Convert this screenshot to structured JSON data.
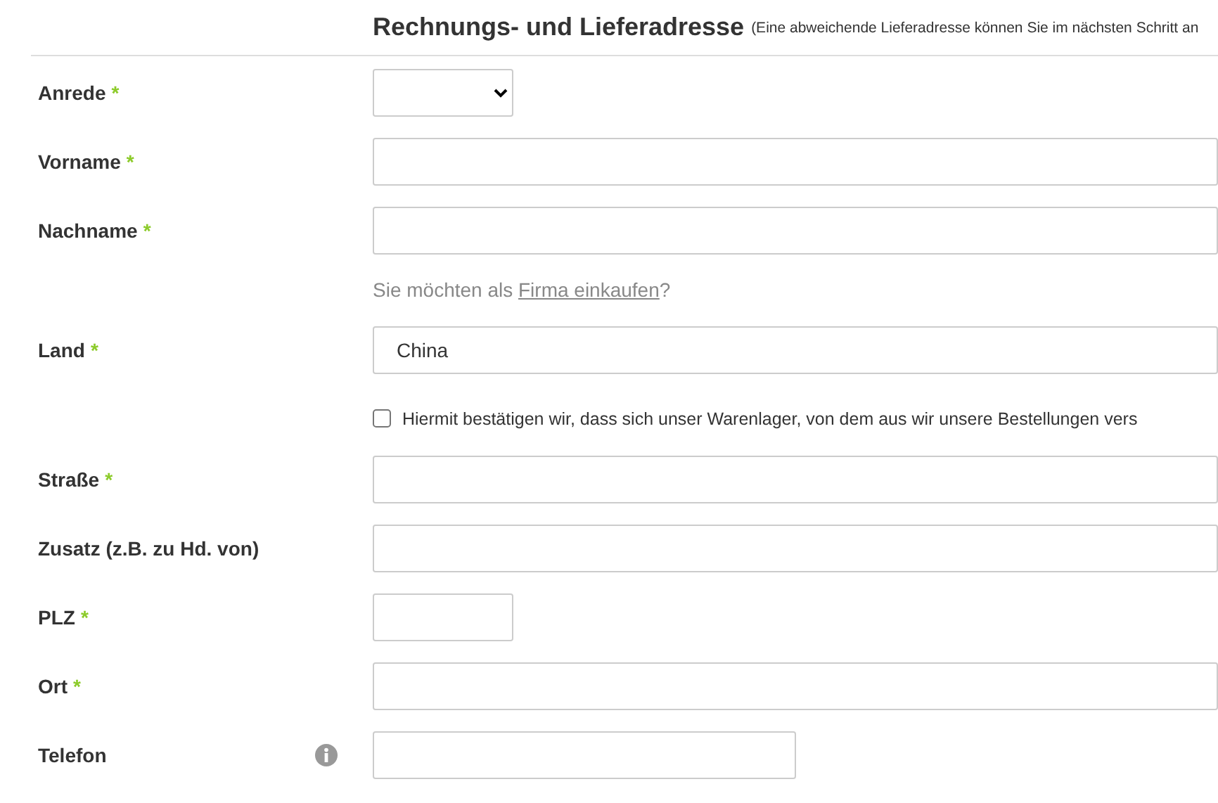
{
  "header": {
    "title": "Rechnungs- und Lieferadresse",
    "note": "(Eine abweichende Lieferadresse können Sie im nächsten Schritt an"
  },
  "rows": [
    {
      "kind": "select",
      "label": "Anrede",
      "required_mark": "*"
    },
    {
      "kind": "wide",
      "label": "Vorname",
      "required_mark": "*"
    },
    {
      "kind": "wide",
      "label": "Nachname",
      "required_mark": "*"
    },
    {
      "kind": "hint",
      "prefix": "Sie möchten als ",
      "link": "Firma einkaufen",
      "suffix": "?"
    },
    {
      "kind": "wide",
      "label": "Land",
      "required_mark": "*",
      "value": "China"
    },
    {
      "kind": "checkbox",
      "checked": false,
      "text": "Hiermit bestätigen wir, dass sich unser Warenlager, von dem aus wir unsere Bestellungen vers"
    },
    {
      "kind": "wide",
      "label": "Straße",
      "required_mark": "*"
    },
    {
      "kind": "wide",
      "label": "Zusatz (z.B. zu Hd. von)"
    },
    {
      "kind": "short",
      "label": "PLZ",
      "required_mark": "*"
    },
    {
      "kind": "wide",
      "label": "Ort",
      "required_mark": "*"
    },
    {
      "kind": "medium",
      "label": "Telefon",
      "info": true
    }
  ]
}
